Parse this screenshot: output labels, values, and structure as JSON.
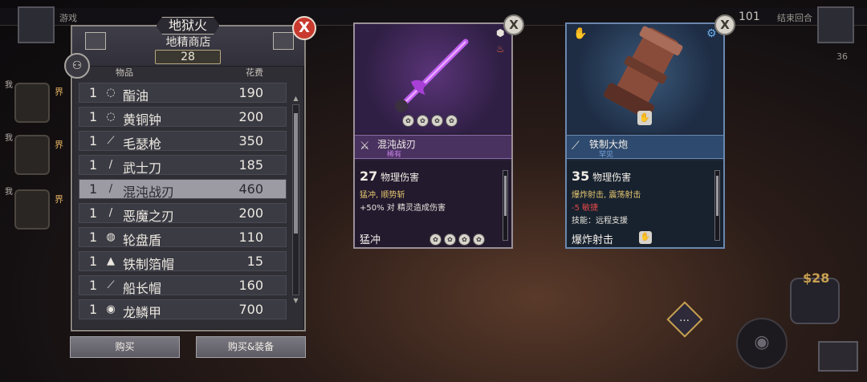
{
  "top_bar": {
    "left_text": "游戏",
    "turn_number": "101",
    "end_turn": "结束回合",
    "right_count": "36"
  },
  "party": {
    "tag": "我",
    "members": [
      {
        "name": "界"
      },
      {
        "name": "界"
      },
      {
        "name": "界"
      }
    ]
  },
  "shop": {
    "title": "地狱火",
    "subtitle": "地精商店",
    "currency": "28",
    "col_item": "物品",
    "col_cost": "花费",
    "close": "X",
    "items": [
      {
        "qty": "1",
        "icon": "ring-icon",
        "glyph": "◌",
        "name": "酯油",
        "price": "190"
      },
      {
        "qty": "1",
        "icon": "bell-icon",
        "glyph": "◌",
        "name": "黄铜钟",
        "price": "200"
      },
      {
        "qty": "1",
        "icon": "gun-icon",
        "glyph": "⟋",
        "name": "毛瑟枪",
        "price": "350"
      },
      {
        "qty": "1",
        "icon": "sword-icon",
        "glyph": "/",
        "name": "武士刀",
        "price": "185"
      },
      {
        "qty": "1",
        "icon": "sword-icon",
        "glyph": "/",
        "name": "混沌战刃",
        "price": "460",
        "selected": true
      },
      {
        "qty": "1",
        "icon": "sword-icon",
        "glyph": "/",
        "name": "恶魔之刃",
        "price": "200"
      },
      {
        "qty": "1",
        "icon": "shield-icon",
        "glyph": "◍",
        "name": "轮盘盾",
        "price": "110"
      },
      {
        "qty": "1",
        "icon": "hat-icon",
        "glyph": "▲",
        "name": "铁制箔帽",
        "price": "15"
      },
      {
        "qty": "1",
        "icon": "feather-icon",
        "glyph": "⟋",
        "name": "船长帽",
        "price": "160"
      },
      {
        "qty": "1",
        "icon": "armor-icon",
        "glyph": "◉",
        "name": "龙鳞甲",
        "price": "700"
      }
    ],
    "buy_label": "购买",
    "buy_equip_label": "购买&装备"
  },
  "cards": [
    {
      "name": "混沌战刃",
      "rarity": "稀有",
      "rarity_color": "#c880e8",
      "damage": "27",
      "damage_type": "物理伤害",
      "traits": "猛冲, 顺势斩",
      "effect": "+50% 对 精灵造成伤害",
      "ability": "猛冲",
      "close": "X"
    },
    {
      "name": "铁制大炮",
      "rarity": "罕见",
      "rarity_color": "#7aa8e0",
      "damage": "35",
      "damage_type": "物理伤害",
      "traits": "爆炸射击, 震荡射击",
      "negative": "-5 敏捷",
      "skill": "技能：远程支援",
      "ability": "爆炸射击",
      "close": "X"
    }
  ],
  "hud": {
    "money": "$28"
  }
}
